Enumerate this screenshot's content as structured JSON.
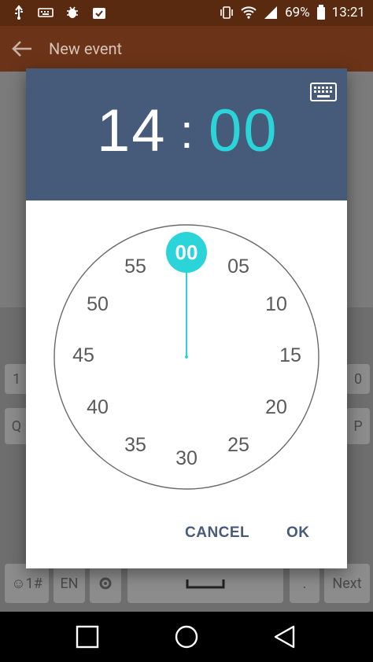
{
  "status_bar": {
    "battery_percent": "69%",
    "time": "13:21"
  },
  "app_bar": {
    "title": "New event"
  },
  "keyboard": {
    "row_keys": [
      "1",
      "0",
      "Q",
      "P"
    ],
    "lang": "EN",
    "emoji_key": "☺1#",
    "period": ".",
    "next": "Next"
  },
  "dialog": {
    "hour": "14",
    "separator": ":",
    "minute": "00",
    "selected_minute_label": "00",
    "clock_labels": [
      "00",
      "05",
      "10",
      "15",
      "20",
      "25",
      "30",
      "35",
      "40",
      "45",
      "50",
      "55"
    ],
    "cancel_label": "CANCEL",
    "ok_label": "OK",
    "colors": {
      "header": "#465a7a",
      "accent": "#2ad4d8",
      "text": "#5a5a5a"
    }
  }
}
